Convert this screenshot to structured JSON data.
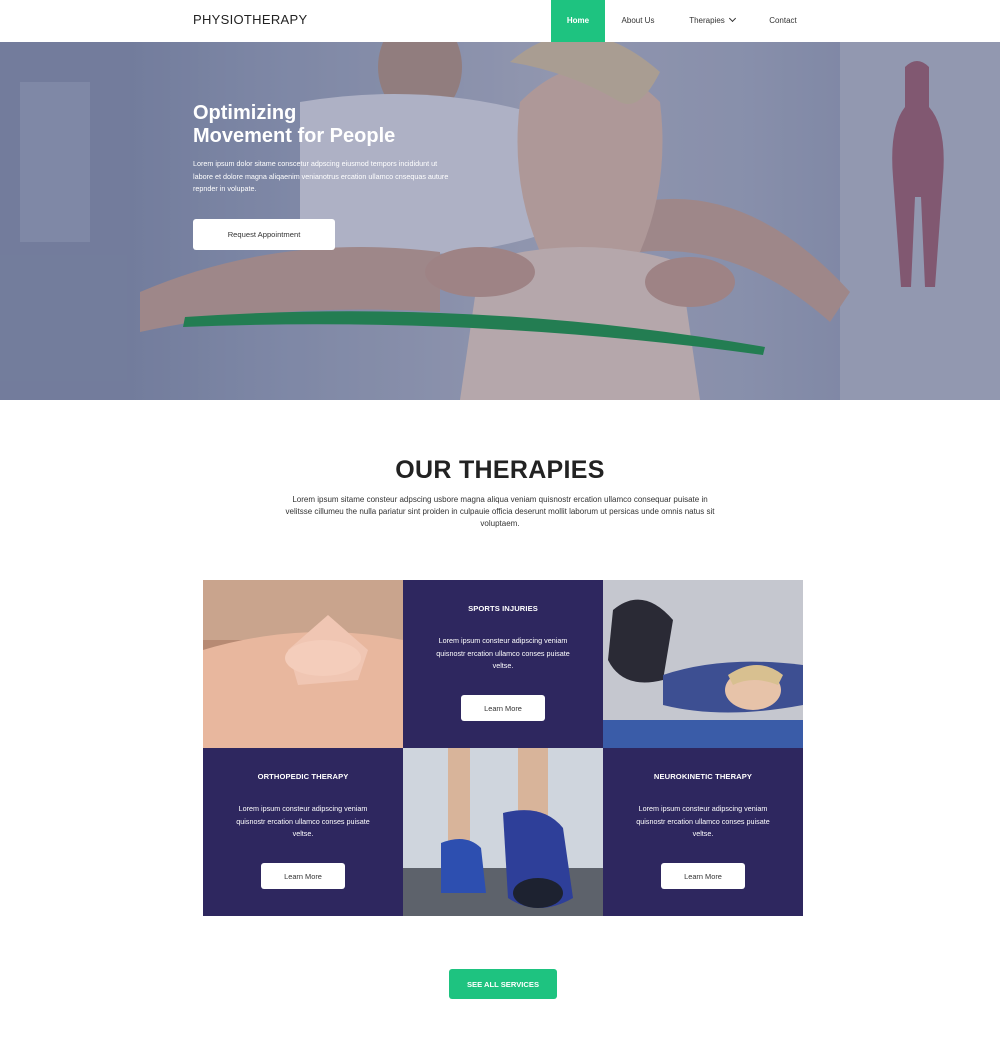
{
  "brand": {
    "name": "PHYSIOTHERAPY"
  },
  "nav": {
    "items": [
      {
        "label": "Home",
        "active": true
      },
      {
        "label": "About Us"
      },
      {
        "label": "Therapies",
        "has_dropdown": true
      },
      {
        "label": "Contact"
      }
    ]
  },
  "hero": {
    "title_line1": "Optimizing",
    "title_line2": "Movement for People",
    "text": "Lorem ipsum dolor sitame conscetur adpscing eiusmod tempors incididunt ut labore et dolore magna aliqaenim venianotrus ercation ullamco cnsequas auture repnder in volupate.",
    "cta_label": "Request Appointment"
  },
  "therapies": {
    "title": "OUR THERAPIES",
    "intro": "Lorem ipsum sitame consteur adpscing usbore magna aliqua veniam quisnostr ercation ullamco consequar puisate in velitsse cillumeu the nulla pariatur sint proiden in culpauie officia deserunt mollit laborum ut persicas unde omnis natus sit voluptaem.",
    "cards": [
      {
        "title": "SPORTS INJURIES",
        "text": "Lorem ipsum consteur adipscing veniam quisnostr ercation ullamco conses puisate veltse.",
        "button": "Learn More"
      },
      {
        "title": "ORTHOPEDIC THERAPY",
        "text": "Lorem ipsum consteur adipscing veniam quisnostr ercation ullamco conses puisate veltse.",
        "button": "Learn More"
      },
      {
        "title": "NEUROKINETIC THERAPY",
        "text": "Lorem ipsum consteur adipscing veniam quisnostr ercation ullamco conses puisate veltse.",
        "button": "Learn More"
      }
    ],
    "see_all_label": "SEE ALL SERVICES"
  },
  "colors": {
    "accent": "#1ec380",
    "card_bg": "#2e275f",
    "text": "#222222"
  }
}
